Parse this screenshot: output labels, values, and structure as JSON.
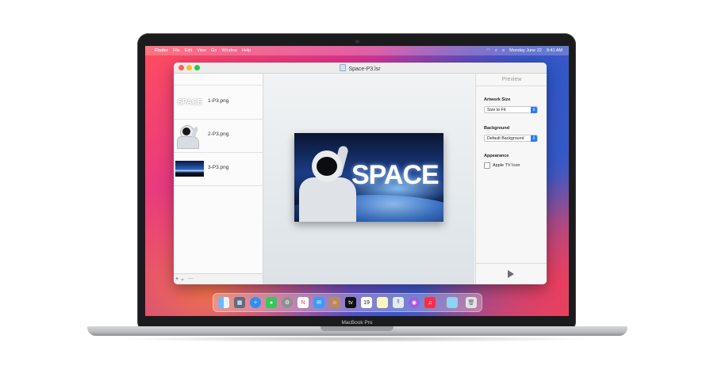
{
  "device": {
    "label": "MacBook Pro"
  },
  "menubar": {
    "items": [
      "Finder",
      "File",
      "Edit",
      "View",
      "Go",
      "Window",
      "Help"
    ],
    "date": "Monday June 22",
    "time": "9:41 AM"
  },
  "window": {
    "title": "Space-P3.lsr",
    "layers": [
      {
        "name": "1-P3.png",
        "thumb_text": "SPACE"
      },
      {
        "name": "2-P3.png"
      },
      {
        "name": "3-P3.png"
      }
    ],
    "add_label": "+",
    "remove_label": "—"
  },
  "artwork": {
    "title": "SPACE"
  },
  "inspector": {
    "header": "Preview",
    "artwork_size": {
      "label": "Artwork Size",
      "value": "Size to Fit"
    },
    "background": {
      "label": "Background",
      "value": "Default Background"
    },
    "appearance": {
      "label": "Appearance",
      "checkbox_label": "Apple TV Icon",
      "checked": false
    }
  },
  "dock": {
    "calendar_day": "19",
    "icons": [
      "finder-icon",
      "launchpad-icon",
      "safari-icon",
      "messages-icon",
      "settings-icon",
      "news-icon",
      "mail-icon",
      "contacts-icon",
      "appletv-icon",
      "calendar-icon",
      "notes-icon",
      "instruments-icon",
      "podcasts-icon",
      "music-icon",
      "preview-icon",
      "trash-icon"
    ]
  },
  "colors": {
    "accent": "#2d7cf6",
    "red": "#ff5f57",
    "yellow": "#febc2e",
    "green": "#28c840"
  }
}
